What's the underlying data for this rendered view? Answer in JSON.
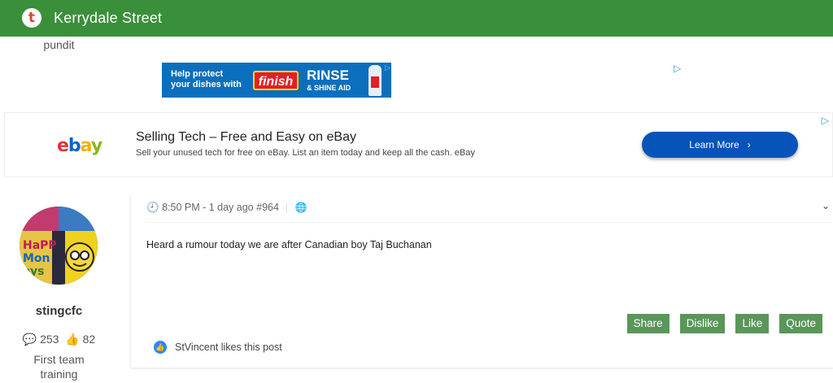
{
  "header": {
    "logo_letter": "t",
    "title": "Kerrydale Street"
  },
  "prev_user": {
    "rank": "pundit"
  },
  "ad_top": {
    "line1": "Help protect",
    "line2": "your dishes with",
    "brand": "finish",
    "product": "RINSE",
    "product_sub": "& SHINE AID",
    "adchoices_icon": "adchoices-icon"
  },
  "ad_ebay": {
    "logo": {
      "e": "e",
      "b": "b",
      "a": "a",
      "y": "y"
    },
    "headline": "Selling Tech – Free and Easy on eBay",
    "description": "Sell your unused tech for free on eBay. List an item today and keep all the cash. eBay",
    "cta": "Learn More",
    "cta_icon": "chevron-right-icon",
    "brand_colors": [
      "#e53238",
      "#0064d2",
      "#f5af02",
      "#86b817"
    ]
  },
  "author": {
    "username": "stingcfc",
    "comments": "253",
    "likes": "82",
    "rank_line1": "First team",
    "rank_line2": "training",
    "avatar_text": {
      "row1": "HaPP",
      "row2": "Mon",
      "row3": "ays"
    }
  },
  "post": {
    "time": "8:50 PM - 1 day ago",
    "number": "#964",
    "body": "Heard a rumour today we are after Canadian boy Taj Buchanan",
    "actions": {
      "share": "Share",
      "dislike": "Dislike",
      "like": "Like",
      "quote": "Quote"
    },
    "likes_text": "StVincent likes this post",
    "accent_color": "#5a965a"
  }
}
